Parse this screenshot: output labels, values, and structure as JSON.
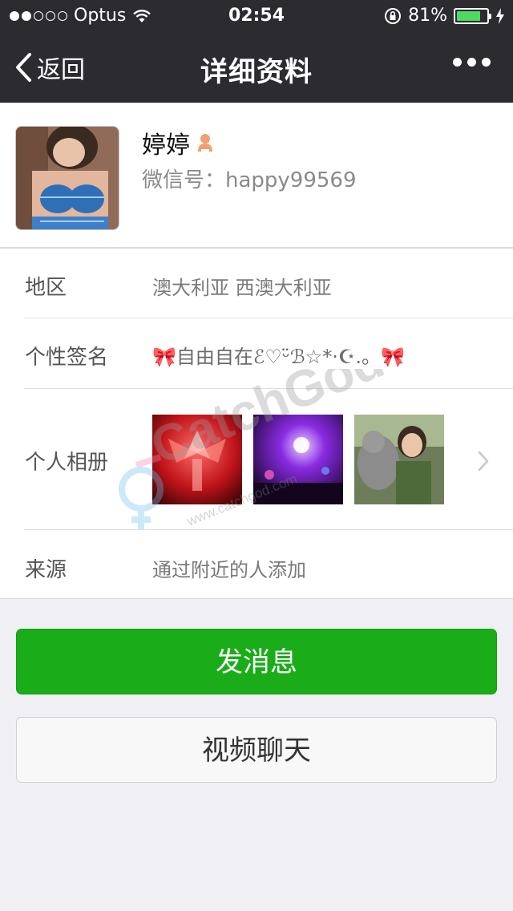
{
  "status_bar": {
    "carrier": "Optus",
    "time": "02:54",
    "battery_percent": "81%",
    "battery_level": 0.81,
    "signal_strength": 2,
    "signal_total": 5
  },
  "nav": {
    "back_label": "返回",
    "title": "详细资料"
  },
  "profile": {
    "name": "婷婷",
    "wechat_id": "微信号：happy99569"
  },
  "details": {
    "region": {
      "label": "地区",
      "value": "澳大利亚 西澳大利亚"
    },
    "signature": {
      "label": "个性签名",
      "value": "🎀自由自在ℰ♡ᵕ̈ℬ☆*·☪︎.。🎀"
    },
    "album": {
      "label": "个人相册"
    },
    "source": {
      "label": "来源",
      "value": "通过附近的人添加"
    }
  },
  "actions": {
    "message_label": "发消息",
    "video_label": "视频聊天"
  },
  "watermark": {
    "text": "CatchGod",
    "url_text": "www.catchgod.com"
  },
  "colors": {
    "nav_bg": "#2b2b30",
    "primary_green": "#1aad19",
    "page_bg": "#efeff4",
    "battery_green": "#4cd964"
  }
}
